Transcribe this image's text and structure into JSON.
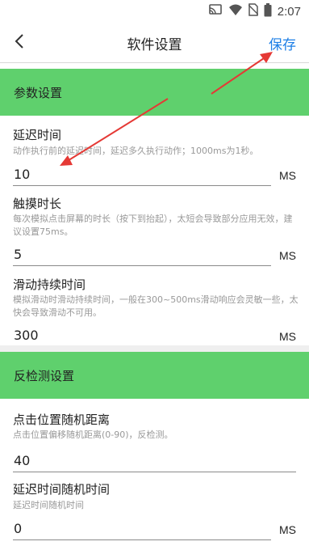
{
  "status_bar": {
    "time": "2:07"
  },
  "app_bar": {
    "title": "软件设置",
    "save_label": "保存"
  },
  "groups": [
    {
      "title": "参数设置",
      "settings": [
        {
          "label": "延迟时间",
          "desc": "动作执行前的延迟时间，延迟多久执行动作；1000ms为1秒。",
          "value": "10",
          "unit": "MS"
        },
        {
          "label": "触摸时长",
          "desc": "每次模拟点击屏幕的时长（按下到抬起），太短会导致部分应用无效，建议设置75ms。",
          "value": "5",
          "unit": "MS"
        },
        {
          "label": "滑动持续时间",
          "desc": "模拟滑动时滑动持续时间，一般在300~500ms滑动响应会灵敏一些，太快会导致滑动不可用。",
          "value": "300",
          "unit": "MS"
        }
      ]
    },
    {
      "title": "反检测设置",
      "settings": [
        {
          "label": "点击位置随机距离",
          "desc": "点击位置偏移随机距离(0-90)，反检测。",
          "value": "40",
          "unit": ""
        },
        {
          "label": "延迟时间随机时间",
          "desc": "延迟时间随机时间",
          "value": "0",
          "unit": "MS"
        }
      ]
    }
  ],
  "annotation_color": "#e53935"
}
